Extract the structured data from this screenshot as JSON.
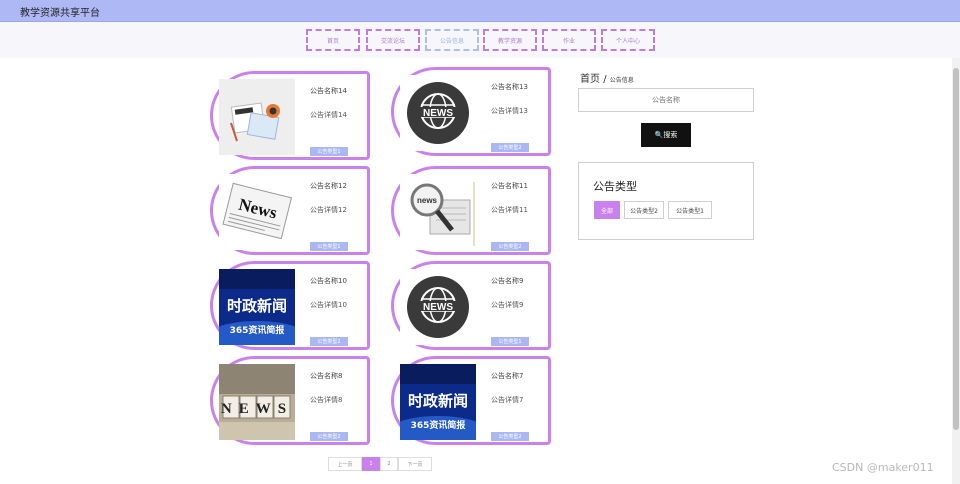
{
  "header": {
    "title": "教学资源共享平台"
  },
  "nav": {
    "items": [
      {
        "label": "首页"
      },
      {
        "label": "交流论坛"
      },
      {
        "label": "公告信息",
        "active": true
      },
      {
        "label": "教学资源"
      },
      {
        "label": "作业"
      },
      {
        "label": "个人中心"
      }
    ]
  },
  "breadcrumb": {
    "home": "首页",
    "separator": "/",
    "current": "公告信息"
  },
  "search": {
    "placeholder": "公告名称",
    "button_label": "🔍搜索"
  },
  "type_filter": {
    "heading": "公告类型",
    "options": [
      {
        "label": "全部",
        "selected": true
      },
      {
        "label": "公告类型2"
      },
      {
        "label": "公告类型1"
      }
    ]
  },
  "notices": [
    {
      "name": "公告名称14",
      "detail": "公告详情14",
      "type": "公告类型1",
      "image": "news-desk"
    },
    {
      "name": "公告名称13",
      "detail": "公告详情13",
      "type": "公告类型2",
      "image": "news-globe"
    },
    {
      "name": "公告名称12",
      "detail": "公告详情12",
      "type": "公告类型1",
      "image": "newspaper"
    },
    {
      "name": "公告名称11",
      "detail": "公告详情11",
      "type": "公告类型2",
      "image": "news-magnifier"
    },
    {
      "name": "公告名称10",
      "detail": "公告详情10",
      "type": "公告类型2",
      "image": "news-broadcast",
      "image_text": "时政新闻",
      "image_subtext": "365资讯简报"
    },
    {
      "name": "公告名称9",
      "detail": "公告详情9",
      "type": "公告类型1",
      "image": "news-globe"
    },
    {
      "name": "公告名称8",
      "detail": "公告详情8",
      "type": "公告类型2",
      "image": "news-cubes",
      "image_text": "NEWS"
    },
    {
      "name": "公告名称7",
      "detail": "公告详情7",
      "type": "公告类型2",
      "image": "news-broadcast",
      "image_text": "时政新闻",
      "image_subtext": "365资讯简报"
    }
  ],
  "pagination": {
    "prev": "上一页",
    "pages": [
      "1",
      "2"
    ],
    "current": "1",
    "next": "下一页"
  },
  "watermark": "CSDN @maker011",
  "colors": {
    "accent": "#c981ec",
    "header_bg": "#aeb8f5",
    "tag_bg": "#a9b8f3",
    "search_btn": "#111111"
  }
}
